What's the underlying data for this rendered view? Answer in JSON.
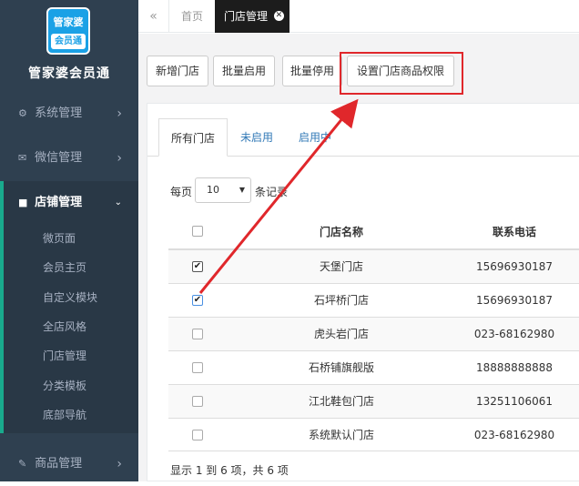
{
  "sidebar": {
    "logo_line1": "管家婆",
    "logo_line2": "会员通",
    "brand": "管家婆会员通",
    "items": [
      {
        "label": "系统管理",
        "icon": "gear-icon"
      },
      {
        "label": "微信管理",
        "icon": "envelope-icon"
      },
      {
        "label": "店铺管理",
        "icon": "store-icon"
      },
      {
        "label": "商品管理",
        "icon": "edit-icon"
      }
    ],
    "submenu": [
      "微页面",
      "会员主页",
      "自定义模块",
      "全店风格",
      "门店管理",
      "分类模板",
      "底部导航"
    ]
  },
  "topbar": {
    "home_tab": "首页",
    "active_tab": "门店管理"
  },
  "toolbar": {
    "add_store": "新增门店",
    "batch_enable": "批量启用",
    "batch_disable": "批量停用",
    "set_permission": "设置门店商品权限"
  },
  "tabs": {
    "all": "所有门店",
    "disabled": "未启用",
    "enabled": "启用中"
  },
  "paging": {
    "per_page_label": "每页",
    "per_page_value": "10",
    "records_label": "条记录",
    "info": "显示 1 到 6 项，共 6 项"
  },
  "table": {
    "col_name": "门店名称",
    "col_phone": "联系电话",
    "rows": [
      {
        "name": "天堡门店",
        "phone": "15696930187",
        "checked": true
      },
      {
        "name": "石坪桥门店",
        "phone": "15696930187",
        "checked": true
      },
      {
        "name": "虎头岩门店",
        "phone": "023-68162980",
        "checked": false
      },
      {
        "name": "石桥铺旗舰版",
        "phone": "18888888888",
        "checked": false
      },
      {
        "name": "江北鞋包门店",
        "phone": "13251106061",
        "checked": false
      },
      {
        "name": "系统默认门店",
        "phone": "023-68162980",
        "checked": false
      }
    ]
  },
  "colors": {
    "sidebar_bg": "#2f4050",
    "accent": "#19aa8d",
    "highlight": "#e0272b",
    "link": "#337ab7"
  }
}
